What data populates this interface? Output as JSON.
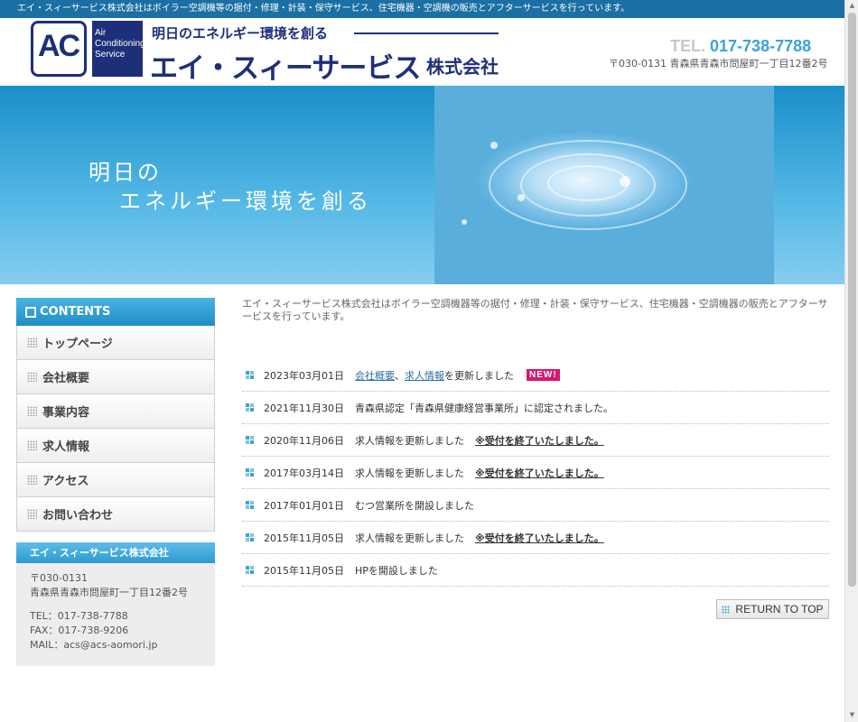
{
  "topbar": {
    "text": "エイ・スィーサービス株式会社はボイラー空調機等の据付・修理・計装・保守サービス、住宅機器・空調機の販売とアフターサービスを行っています。"
  },
  "header": {
    "logo_ac": "AC",
    "logo_side": "Air Conditioning Service",
    "slogan": "明日のエネルギー環境を創る",
    "brand": "エイ・スィーサービス",
    "brand_suffix": "株式会社",
    "tel_label": "TEL.",
    "tel_number": "017-738-7788",
    "address": "〒030-0131 青森県青森市問屋町一丁目12番2号"
  },
  "hero": {
    "line1": "明日の",
    "line2": "エネルギー環境を創る"
  },
  "sidebar": {
    "contents_title": "CONTENTS",
    "items": [
      {
        "label": "トップページ"
      },
      {
        "label": "会社概要"
      },
      {
        "label": "事業内容"
      },
      {
        "label": "求人情報"
      },
      {
        "label": "アクセス"
      },
      {
        "label": "お問い合わせ"
      }
    ],
    "company": {
      "title": "エイ・スィーサービス株式会社",
      "postal": "〒030-0131",
      "address": "青森県青森市問屋町一丁目12番2号",
      "tel": "TEL：017-738-7788",
      "fax": "FAX：017-738-9206",
      "mail": "MAIL：acs@acs-aomori.jp"
    }
  },
  "main": {
    "intro": "エイ・スィーサービス株式会社はボイラー空調機器等の据付・修理・計装・保守サービス、住宅機器・空調機器の販売とアフターサービスを行っています。",
    "news": [
      {
        "date": "2023年03月01日",
        "link1": "会社概要",
        "sep": "、",
        "link2": "求人情報",
        "text": "を更新しました",
        "badge": "NEW!"
      },
      {
        "date": "2021年11月30日",
        "text": "青森県認定「青森県健康経営事業所」に認定されました。"
      },
      {
        "date": "2020年11月06日",
        "text": "求人情報を更新しました",
        "notice": "※受付を終了いたしました。"
      },
      {
        "date": "2017年03月14日",
        "text": "求人情報を更新しました",
        "notice": "※受付を終了いたしました。"
      },
      {
        "date": "2017年01月01日",
        "text": "むつ営業所を開設しました"
      },
      {
        "date": "2015年11月05日",
        "text": "求人情報を更新しました",
        "notice": "※受付を終了いたしました。"
      },
      {
        "date": "2015年11月05日",
        "text": "HPを開設しました"
      }
    ],
    "return_label": "RETURN TO TOP"
  },
  "colors": {
    "brand_navy": "#1e2f7a",
    "accent_blue": "#3aa3d6",
    "topbar": "#1a6fa3",
    "badge": "#d6176b"
  }
}
